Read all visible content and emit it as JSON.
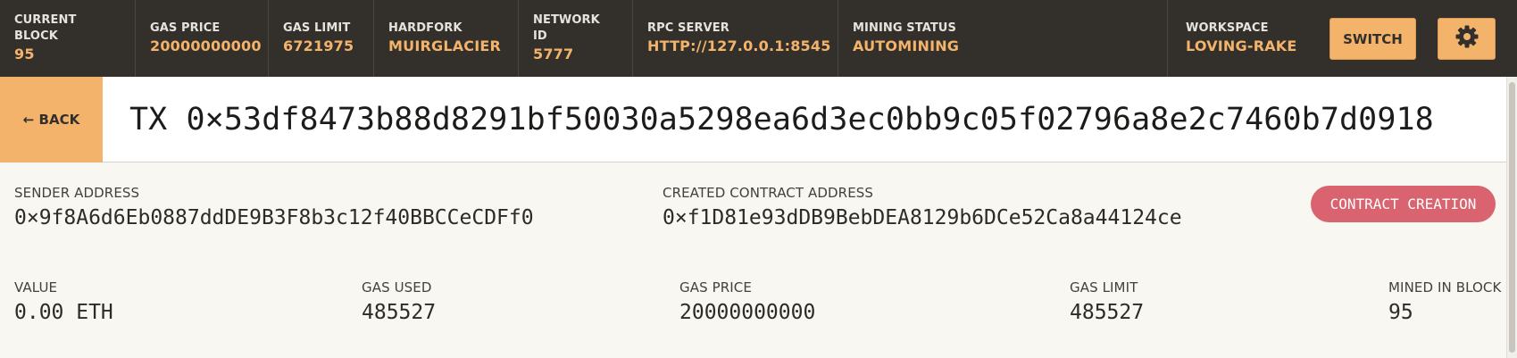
{
  "topbar": {
    "stats": [
      {
        "label": "CURRENT BLOCK",
        "value": "95"
      },
      {
        "label": "GAS PRICE",
        "value": "20000000000"
      },
      {
        "label": "GAS LIMIT",
        "value": "6721975"
      },
      {
        "label": "HARDFORK",
        "value": "MUIRGLACIER"
      },
      {
        "label": "NETWORK ID",
        "value": "5777"
      },
      {
        "label": "RPC SERVER",
        "value": "HTTP://127.0.0.1:8545"
      },
      {
        "label": "MINING STATUS",
        "value": "AUTOMINING"
      }
    ],
    "workspace": {
      "label": "WORKSPACE",
      "value": "LOVING-RAKE"
    },
    "switch_label": "SWITCH",
    "settings_icon": "gear-icon"
  },
  "tx": {
    "back_label": "← BACK",
    "title": "TX 0×53df8473b88d8291bf50030a5298ea6d3ec0bb9c05f02796a8e2c7460b7d0918"
  },
  "details": {
    "sender": {
      "label": "SENDER ADDRESS",
      "value": "0×9f8A6d6Eb0887ddDE9B3F8b3c12f40BBCCeCDFf0"
    },
    "contract": {
      "label": "CREATED CONTRACT ADDRESS",
      "value": "0×f1D81e93dDB9BebDEA8129b6DCe52Ca8a44124ce"
    },
    "badge": "CONTRACT CREATION",
    "value": {
      "label": "VALUE",
      "value": "0.00 ETH"
    },
    "gas_used": {
      "label": "GAS USED",
      "value": "485527"
    },
    "gas_price": {
      "label": "GAS PRICE",
      "value": "20000000000"
    },
    "gas_limit": {
      "label": "GAS LIMIT",
      "value": "485527"
    },
    "mined_in_block": {
      "label": "MINED IN BLOCK",
      "value": "95"
    }
  },
  "colors": {
    "topbar_bg": "#33302c",
    "accent": "#f4b36b",
    "badge": "#d96470",
    "page_bg": "#f9f7f2"
  }
}
